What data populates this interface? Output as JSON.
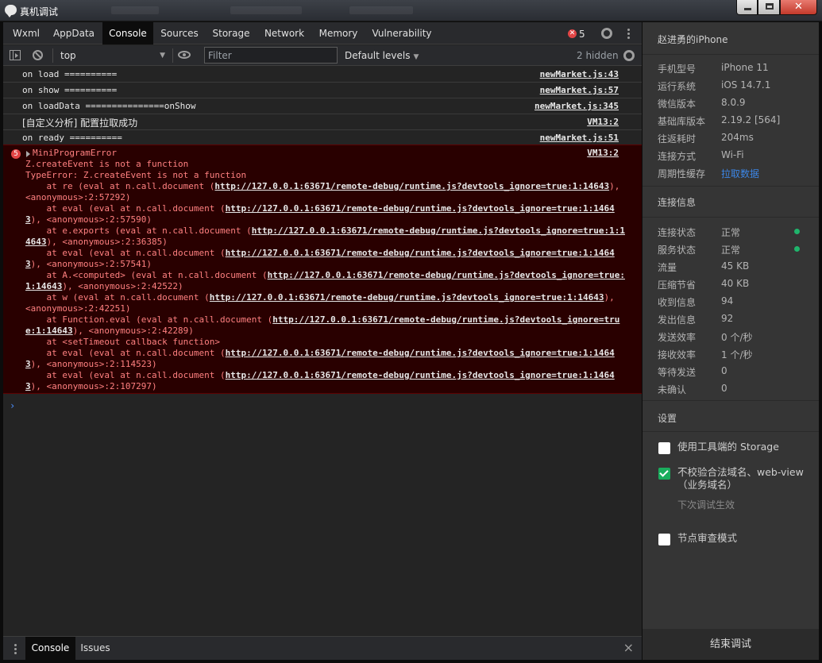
{
  "window": {
    "title": "真机调试"
  },
  "tabs": [
    "Wxml",
    "AppData",
    "Console",
    "Sources",
    "Storage",
    "Network",
    "Memory",
    "Vulnerability"
  ],
  "active_tab": "Console",
  "error_count": "5",
  "toolbar": {
    "context": "top",
    "filter_placeholder": "Filter",
    "levels_label": "Default levels",
    "hidden_label": "2 hidden"
  },
  "messages": [
    {
      "text": "on load ==========",
      "source": "newMarket.js:43"
    },
    {
      "text": "on show ==========",
      "source": "newMarket.js:57"
    },
    {
      "text": "on loadData ===============onShow",
      "source": "newMarket.js:345"
    },
    {
      "text": "[自定义分析] 配置拉取成功",
      "source": "VM13:2"
    },
    {
      "text": "on ready ==========",
      "source": "newMarket.js:51"
    }
  ],
  "error": {
    "badge": "5",
    "title": "MiniProgramError",
    "source": "VM13:2",
    "line1": "Z.createEvent is not a function",
    "line2": "TypeError: Z.createEvent is not a function",
    "url_a": "http://127.0.0.1:63671/remote-debug/runtime.js?devtools_ignore=true:1:14643",
    "stack": [
      {
        "pre": "    at re (eval at n.call.document (",
        "link": "http://127.0.0.1:63671/remote-debug/runtime.js?devtools_ignore=true:1:14643",
        "post": "),",
        "wrap": "<anonymous>:2:57292)"
      },
      {
        "pre": "    at eval (eval at n.call.document (",
        "link": "http://127.0.0.1:63671/remote-debug/runtime.js?devtools_ignore=true:1:1464",
        "post": "",
        "wrap_link": "3",
        "wrap": "), <anonymous>:2:57590)"
      },
      {
        "pre": "    at e.exports (eval at n.call.document (",
        "link": "http://127.0.0.1:63671/remote-debug/runtime.js?devtools_ignore=true:1:1",
        "post": "",
        "wrap_link": "4643",
        "wrap": "), <anonymous>:2:36385)"
      },
      {
        "pre": "    at eval (eval at n.call.document (",
        "link": "http://127.0.0.1:63671/remote-debug/runtime.js?devtools_ignore=true:1:1464",
        "post": "",
        "wrap_link": "3",
        "wrap": "), <anonymous>:2:57541)"
      },
      {
        "pre": "    at A.<computed> (eval at n.call.document (",
        "link": "http://127.0.0.1:63671/remote-debug/runtime.js?devtools_ignore=true:",
        "post": "",
        "wrap_link": "1:14643",
        "wrap": "), <anonymous>:2:42522)"
      },
      {
        "pre": "    at w (eval at n.call.document (",
        "link": "http://127.0.0.1:63671/remote-debug/runtime.js?devtools_ignore=true:1:14643",
        "post": "),",
        "wrap": "<anonymous>:2:42251)"
      },
      {
        "pre": "    at Function.eval (eval at n.call.document (",
        "link": "http://127.0.0.1:63671/remote-debug/runtime.js?devtools_ignore=tru",
        "post": "",
        "wrap_link": "e:1:14643",
        "wrap": "), <anonymous>:2:42289)"
      },
      {
        "pre": "    at <setTimeout callback function>",
        "link": "",
        "post": ""
      },
      {
        "pre": "    at eval (eval at n.call.document (",
        "link": "http://127.0.0.1:63671/remote-debug/runtime.js?devtools_ignore=true:1:1464",
        "post": "",
        "wrap_link": "3",
        "wrap": "), <anonymous>:2:114523)"
      },
      {
        "pre": "    at eval (eval at n.call.document (",
        "link": "http://127.0.0.1:63671/remote-debug/runtime.js?devtools_ignore=true:1:1464",
        "post": "",
        "wrap_link": "3",
        "wrap": "), <anonymous>:2:107297)"
      }
    ]
  },
  "prompt": "›",
  "drawer": {
    "tabs": [
      "Console",
      "Issues"
    ],
    "close": "×"
  },
  "panel": {
    "device_name": "赵进勇的iPhone",
    "device_info": [
      {
        "k": "手机型号",
        "v": "iPhone 11"
      },
      {
        "k": "运行系统",
        "v": "iOS 14.7.1"
      },
      {
        "k": "微信版本",
        "v": "8.0.9"
      },
      {
        "k": "基础库版本",
        "v": "2.19.2 [564]"
      },
      {
        "k": "往返耗时",
        "v": "204ms"
      },
      {
        "k": "连接方式",
        "v": "Wi-Fi"
      },
      {
        "k": "周期性缓存",
        "v": "拉取数据",
        "link": true
      }
    ],
    "conn_title": "连接信息",
    "conn_info": [
      {
        "k": "连接状态",
        "v": "正常",
        "dot": true
      },
      {
        "k": "服务状态",
        "v": "正常",
        "dot": true
      },
      {
        "k": "流量",
        "v": "45 KB"
      },
      {
        "k": "压缩节省",
        "v": "40 KB"
      },
      {
        "k": "收到信息",
        "v": "94"
      },
      {
        "k": "发出信息",
        "v": "92"
      },
      {
        "k": "发送效率",
        "v": "0 个/秒"
      },
      {
        "k": "接收效率",
        "v": "1 个/秒"
      },
      {
        "k": "等待发送",
        "v": "0"
      },
      {
        "k": "未确认",
        "v": "0"
      }
    ],
    "settings_title": "设置",
    "settings": [
      {
        "label": "使用工具端的 Storage",
        "checked": false
      },
      {
        "label": "不校验合法域名、web-view（业务域名）",
        "checked": true,
        "hint": "下次调试生效"
      },
      {
        "label": "节点审查模式",
        "checked": false
      }
    ],
    "end_button": "结束调试"
  },
  "colors": {
    "error_bg": "#290000",
    "error_text": "#ff8080",
    "link_blue": "#3c86e6",
    "status_green": "#1fb56c",
    "checkbox_green": "#1aad5d"
  }
}
